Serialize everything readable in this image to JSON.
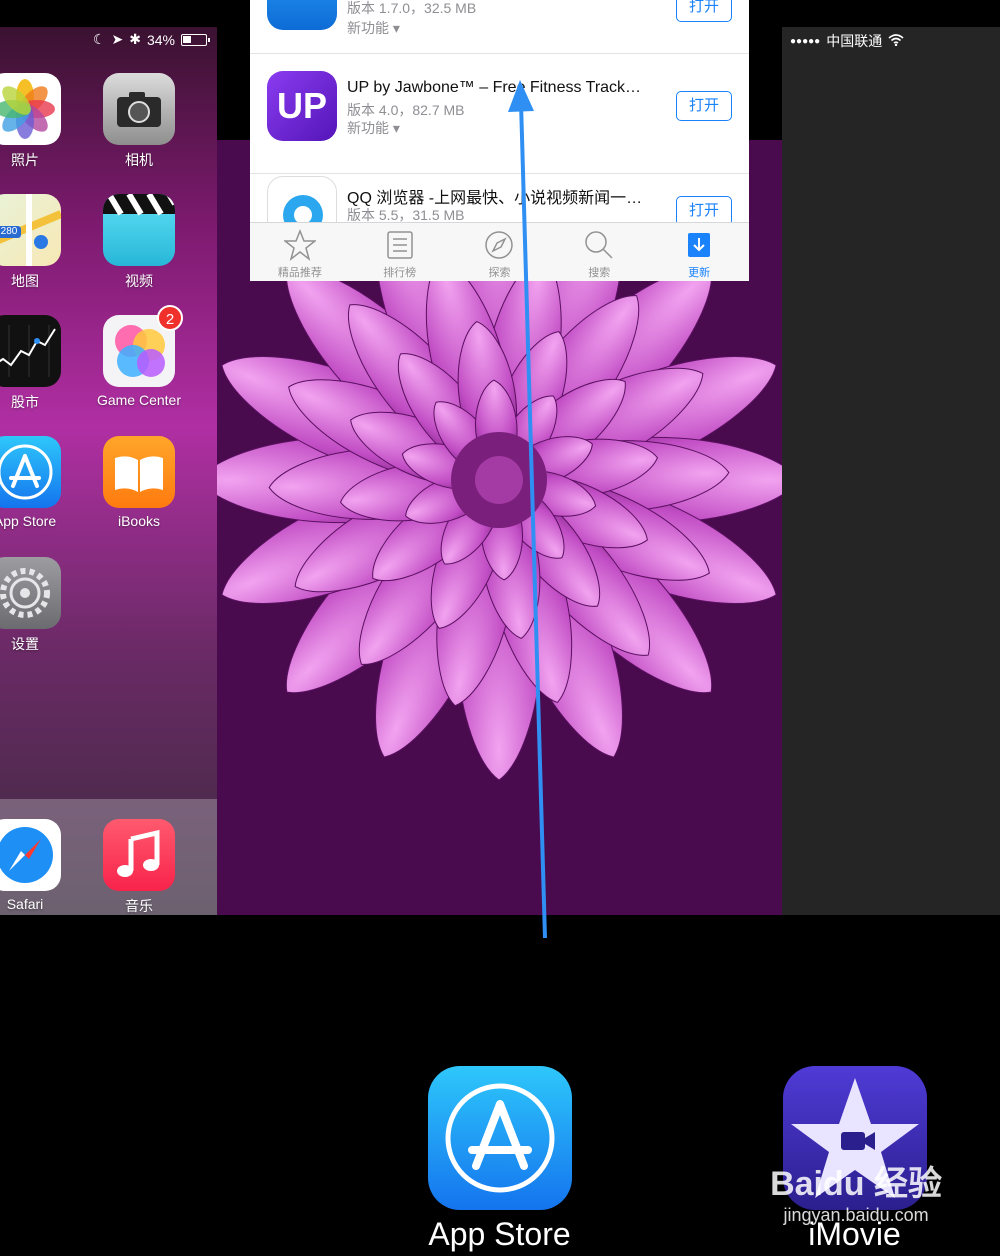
{
  "home_card": {
    "status": {
      "battery": "34%"
    },
    "apps": [
      {
        "label": "照片",
        "icon": "photos-icon"
      },
      {
        "label": "相机",
        "icon": "camera-icon"
      },
      {
        "label": "地图",
        "icon": "maps-icon"
      },
      {
        "label": "视频",
        "icon": "videos-icon"
      },
      {
        "label": "股市",
        "icon": "stocks-icon"
      },
      {
        "label": "Game Center",
        "icon": "game-center-icon",
        "badge": "2"
      },
      {
        "label": "App Store",
        "icon": "app-store-icon"
      },
      {
        "label": "iBooks",
        "icon": "ibooks-icon"
      },
      {
        "label": "设置",
        "icon": "settings-icon"
      }
    ],
    "dock": [
      {
        "label": "Safari",
        "icon": "safari-icon"
      },
      {
        "label": "音乐",
        "icon": "music-icon"
      }
    ],
    "maps_badge": "280"
  },
  "app_store": {
    "rows": [
      {
        "name": "",
        "meta": "版本 1.7.0，32.5 MB",
        "feature": "新功能 ▾",
        "button": "打开",
        "icon": "wifi-app-icon"
      },
      {
        "name": "UP by Jawbone™ – Free Fitness Track…",
        "meta": "版本 4.0，82.7 MB",
        "feature": "新功能 ▾",
        "button": "打开",
        "icon": "up-jawbone-icon",
        "icon_text": "UP"
      },
      {
        "name": "QQ 浏览器 -上网最快、小说视频新闻一…",
        "meta": "版本 5.5，31.5 MB",
        "feature": "",
        "button": "打开",
        "icon": "qq-browser-icon"
      }
    ],
    "tabs": [
      {
        "label": "精品推荐",
        "icon": "star-icon",
        "active": false
      },
      {
        "label": "排行榜",
        "icon": "list-icon",
        "active": false
      },
      {
        "label": "探索",
        "icon": "compass-icon",
        "active": false
      },
      {
        "label": "搜索",
        "icon": "search-icon",
        "active": false
      },
      {
        "label": "更新",
        "icon": "download-icon",
        "active": true
      }
    ]
  },
  "right_card": {
    "status": {
      "signal": "●●●●●",
      "carrier": "中国联通"
    }
  },
  "switcher_labels": [
    {
      "label": "App Store",
      "icon": "app-store-icon"
    },
    {
      "label": "iMovie",
      "icon": "imovie-icon"
    }
  ],
  "watermark": {
    "brand": "Baidu 经验",
    "url": "jingyan.baidu.com"
  },
  "colors": {
    "accent": "#1a82fb",
    "arrow": "#2f8ff3"
  }
}
